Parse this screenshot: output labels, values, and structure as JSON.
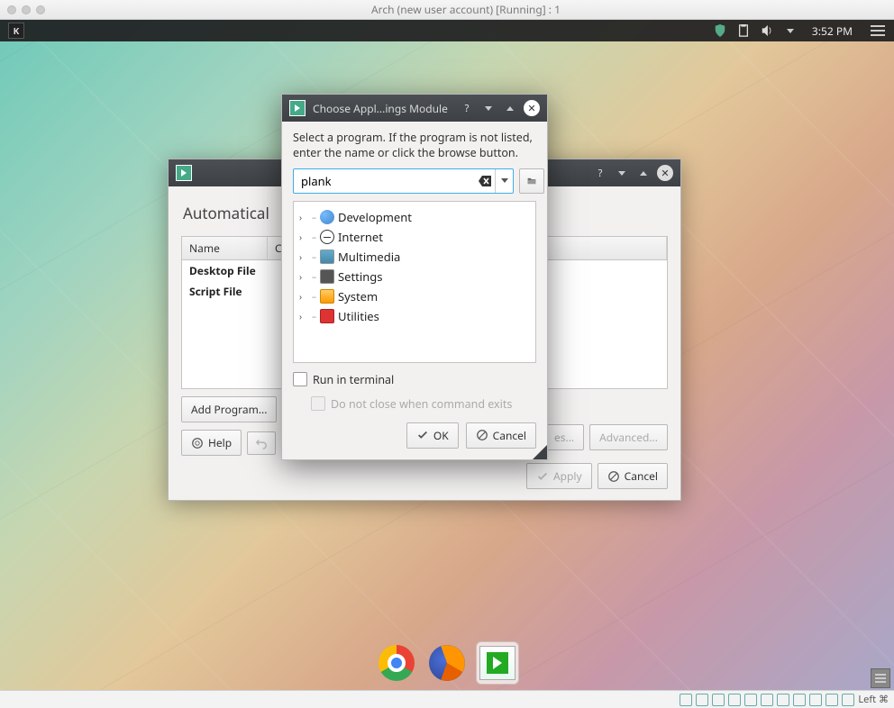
{
  "host": {
    "title": "Arch (new user account) [Running] : 1",
    "status_text": "Left ⌘"
  },
  "panel": {
    "clock": "3:52 PM"
  },
  "autostart": {
    "section_title": "Automatical",
    "col_name": "Name",
    "col_cmd": "C",
    "rows": [
      "Desktop File",
      "Script File"
    ],
    "add_program": "Add Program...",
    "properties": "es...",
    "advanced": "Advanced...",
    "help": "Help",
    "apply": "Apply",
    "cancel": "Cancel"
  },
  "dialog": {
    "title": "Choose Appl...ings Module",
    "instr": "Select a program. If the program is not listed, enter the name or click the browse button.",
    "search_value": "plank",
    "categories": [
      "Development",
      "Internet",
      "Multimedia",
      "Settings",
      "System",
      "Utilities"
    ],
    "run_terminal": "Run in terminal",
    "no_close": "Do not close when command exits",
    "ok": "OK",
    "cancel": "Cancel"
  }
}
